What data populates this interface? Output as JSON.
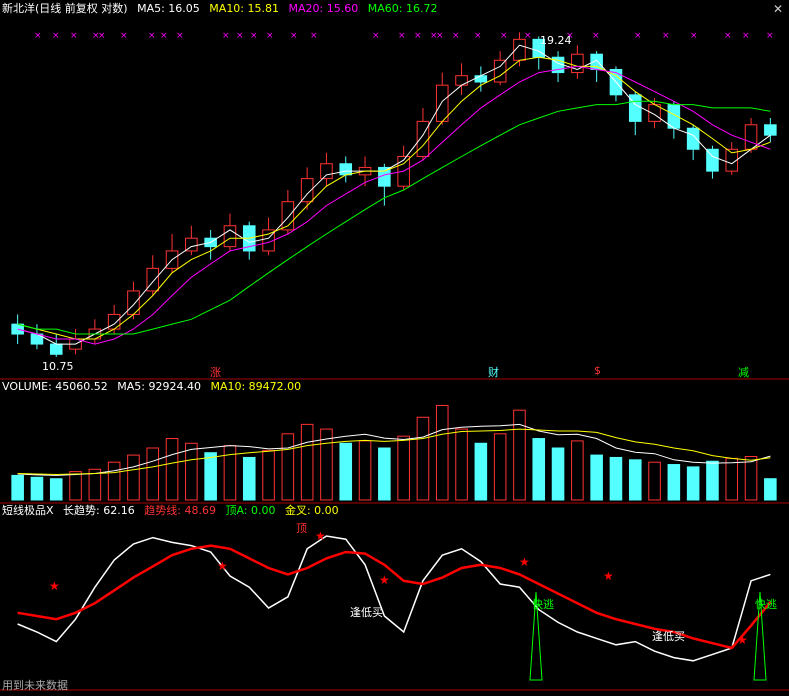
{
  "header": {
    "stock": "新北洋(日线 前复权 对数)",
    "ma5": "MA5: 16.05",
    "ma10": "MA10: 15.81",
    "ma20": "MA20: 15.60",
    "ma60": "MA60: 16.72"
  },
  "volume_header": {
    "volume": "VOLUME: 45060.52",
    "ma5": "MA5: 92924.40",
    "ma10": "MA10: 89472.00"
  },
  "indicator_header": {
    "name": "短线极品X",
    "long_trend": "长趋势: 62.16",
    "trend_line": "趋势线: 48.69",
    "top_a": "顶A: 0.00",
    "golden_cross": "金叉: 0.00"
  },
  "annotations": {
    "high": "19.24",
    "low": "10.75",
    "event_rise": "涨",
    "event_finance": "财",
    "event_dollar": "$",
    "event_reduce": "减",
    "low_buy_1": "逢低买",
    "low_buy_2": "逢低买",
    "quick_escape_1": "快逃",
    "quick_escape_2": "快逃",
    "top_mark": "顶",
    "footer": "用到未来数据"
  },
  "colors": {
    "ma5": "#ffffff",
    "ma10": "#ffff00",
    "ma20": "#ff00ff",
    "ma60": "#00ff00",
    "up": "#ff3333",
    "down": "#54ffff",
    "trend": "#ff0000"
  },
  "chart_data": [
    {
      "type": "candlestick",
      "title": "新北洋(日线 前复权 对数)",
      "y_scale": "log",
      "ylim": [
        10.5,
        19.6
      ],
      "series": [
        {
          "name": "MA5",
          "values": [
            11.3,
            11.2,
            11.0,
            11.0,
            11.2,
            11.4,
            11.8,
            12.3,
            12.8,
            13.1,
            13.2,
            13.5,
            13.2,
            13.3,
            13.8,
            14.4,
            14.9,
            15.0,
            15.0,
            15.0,
            15.3,
            16.0,
            17.0,
            17.5,
            17.8,
            18.1,
            18.8,
            18.6,
            18.2,
            18.0,
            18.3,
            17.6,
            16.9,
            16.6,
            16.2,
            16.0,
            15.4,
            15.2,
            15.6,
            16.0
          ]
        },
        {
          "name": "MA10",
          "values": [
            11.4,
            11.3,
            11.2,
            11.1,
            11.1,
            11.3,
            11.6,
            12.0,
            12.5,
            12.8,
            13.0,
            13.3,
            13.3,
            13.4,
            13.6,
            14.1,
            14.6,
            14.9,
            15.0,
            15.0,
            15.2,
            15.7,
            16.4,
            17.0,
            17.5,
            17.8,
            18.3,
            18.4,
            18.3,
            18.1,
            18.1,
            17.8,
            17.3,
            16.9,
            16.6,
            16.3,
            15.9,
            15.5,
            15.6,
            15.8
          ]
        },
        {
          "name": "MA20",
          "values": [
            11.3,
            11.2,
            11.1,
            11.1,
            11.0,
            11.1,
            11.3,
            11.6,
            12.0,
            12.4,
            12.7,
            13.0,
            13.1,
            13.2,
            13.4,
            13.7,
            14.1,
            14.4,
            14.7,
            14.9,
            15.0,
            15.3,
            15.8,
            16.3,
            16.8,
            17.2,
            17.6,
            17.9,
            18.0,
            18.1,
            18.0,
            17.9,
            17.6,
            17.3,
            17.0,
            16.7,
            16.3,
            16.0,
            15.8,
            15.6
          ]
        },
        {
          "name": "MA60",
          "values": [
            11.4,
            11.3,
            11.3,
            11.2,
            11.2,
            11.2,
            11.2,
            11.3,
            11.4,
            11.5,
            11.7,
            11.9,
            12.2,
            12.5,
            12.8,
            13.1,
            13.4,
            13.7,
            14.0,
            14.3,
            14.5,
            14.8,
            15.1,
            15.4,
            15.7,
            16.0,
            16.3,
            16.5,
            16.7,
            16.8,
            16.9,
            16.9,
            17.0,
            17.0,
            16.9,
            16.9,
            16.8,
            16.8,
            16.8,
            16.7
          ]
        }
      ],
      "candles": [
        [
          11.4,
          11.2,
          11.6,
          11.0
        ],
        [
          11.2,
          11.0,
          11.4,
          10.9
        ],
        [
          11.0,
          10.8,
          11.2,
          10.75
        ],
        [
          10.9,
          11.1,
          11.3,
          10.8
        ],
        [
          11.1,
          11.3,
          11.5,
          11.0
        ],
        [
          11.3,
          11.6,
          11.8,
          11.2
        ],
        [
          11.6,
          12.1,
          12.3,
          11.5
        ],
        [
          12.1,
          12.6,
          12.9,
          12.0
        ],
        [
          12.6,
          13.0,
          13.4,
          12.5
        ],
        [
          13.0,
          13.3,
          13.6,
          12.9
        ],
        [
          13.3,
          13.1,
          13.5,
          12.8
        ],
        [
          13.1,
          13.6,
          13.9,
          13.0
        ],
        [
          13.6,
          13.0,
          13.7,
          12.8
        ],
        [
          13.0,
          13.5,
          13.8,
          12.9
        ],
        [
          13.5,
          14.2,
          14.5,
          13.4
        ],
        [
          14.2,
          14.8,
          15.1,
          14.0
        ],
        [
          14.8,
          15.2,
          15.5,
          14.6
        ],
        [
          15.2,
          14.9,
          15.4,
          14.7
        ],
        [
          14.9,
          15.1,
          15.4,
          14.6
        ],
        [
          15.1,
          14.6,
          15.2,
          14.1
        ],
        [
          14.6,
          15.4,
          15.7,
          14.5
        ],
        [
          15.4,
          16.4,
          16.8,
          15.3
        ],
        [
          16.4,
          17.5,
          17.9,
          16.3
        ],
        [
          17.5,
          17.8,
          18.2,
          17.2
        ],
        [
          17.8,
          17.6,
          18.1,
          17.3
        ],
        [
          17.6,
          18.3,
          18.6,
          17.5
        ],
        [
          18.3,
          19.0,
          19.24,
          18.1
        ],
        [
          19.0,
          18.4,
          19.1,
          18.0
        ],
        [
          18.4,
          17.9,
          18.6,
          17.6
        ],
        [
          17.9,
          18.5,
          18.8,
          17.7
        ],
        [
          18.5,
          18.0,
          18.6,
          17.6
        ],
        [
          18.0,
          17.2,
          18.1,
          17.0
        ],
        [
          17.2,
          16.4,
          17.3,
          16.0
        ],
        [
          16.4,
          16.9,
          17.1,
          16.2
        ],
        [
          16.9,
          16.2,
          17.0,
          15.9
        ],
        [
          16.2,
          15.6,
          16.3,
          15.3
        ],
        [
          15.6,
          15.0,
          15.7,
          14.8
        ],
        [
          15.0,
          15.6,
          15.8,
          14.9
        ],
        [
          15.6,
          16.3,
          16.5,
          15.5
        ],
        [
          16.3,
          16.0,
          16.5,
          15.8
        ]
      ]
    },
    {
      "type": "bar",
      "title": "VOLUME",
      "ylim": [
        0,
        220000
      ],
      "values": [
        52000,
        48000,
        45000,
        60000,
        65000,
        80000,
        95000,
        110000,
        130000,
        120000,
        100000,
        115000,
        90000,
        105000,
        140000,
        160000,
        150000,
        120000,
        125000,
        110000,
        135000,
        175000,
        200000,
        150000,
        120000,
        140000,
        190000,
        130000,
        110000,
        125000,
        95000,
        90000,
        85000,
        80000,
        75000,
        70000,
        82000,
        88000,
        92000,
        45060.52
      ],
      "series": [
        {
          "name": "MA5",
          "values": [
            55000,
            53000,
            52000,
            54000,
            56000,
            62000,
            70000,
            82000,
            96000,
            107000,
            111000,
            115000,
            113000,
            108000,
            110000,
            122000,
            129000,
            135000,
            139000,
            131000,
            128000,
            133000,
            149000,
            154000,
            156000,
            157000,
            160000,
            146000,
            138000,
            139000,
            130000,
            110000,
            101000,
            98000,
            85000,
            80000,
            78000,
            79000,
            81000,
            92924.4
          ]
        },
        {
          "name": "MA10",
          "values": [
            56000,
            55000,
            54000,
            55000,
            56000,
            58000,
            64000,
            70000,
            78000,
            85000,
            90000,
            96000,
            100000,
            103000,
            107000,
            115000,
            120000,
            124000,
            126000,
            124000,
            126000,
            130000,
            139000,
            145000,
            146000,
            147000,
            150000,
            148000,
            146000,
            146000,
            143000,
            132000,
            123000,
            118000,
            110000,
            104000,
            94000,
            88000,
            84000,
            89472.0
          ]
        }
      ]
    },
    {
      "type": "line",
      "title": "短线极品X",
      "ylim": [
        0,
        100
      ],
      "series": [
        {
          "name": "长趋势",
          "values": [
            35,
            30,
            24,
            38,
            58,
            75,
            85,
            89,
            86,
            84,
            80,
            65,
            58,
            45,
            52,
            82,
            90,
            88,
            72,
            40,
            30,
            62,
            78,
            82,
            74,
            60,
            58,
            44,
            36,
            30,
            26,
            22,
            24,
            18,
            14,
            12,
            16,
            20,
            62,
            66
          ]
        },
        {
          "name": "趋势线",
          "values": [
            42,
            40,
            38,
            42,
            48,
            56,
            64,
            71,
            78,
            82,
            84,
            82,
            76,
            70,
            66,
            70,
            76,
            80,
            79,
            72,
            62,
            60,
            64,
            70,
            72,
            70,
            66,
            60,
            54,
            48,
            42,
            38,
            35,
            32,
            30,
            26,
            23,
            20,
            34,
            48.69
          ]
        }
      ]
    }
  ]
}
